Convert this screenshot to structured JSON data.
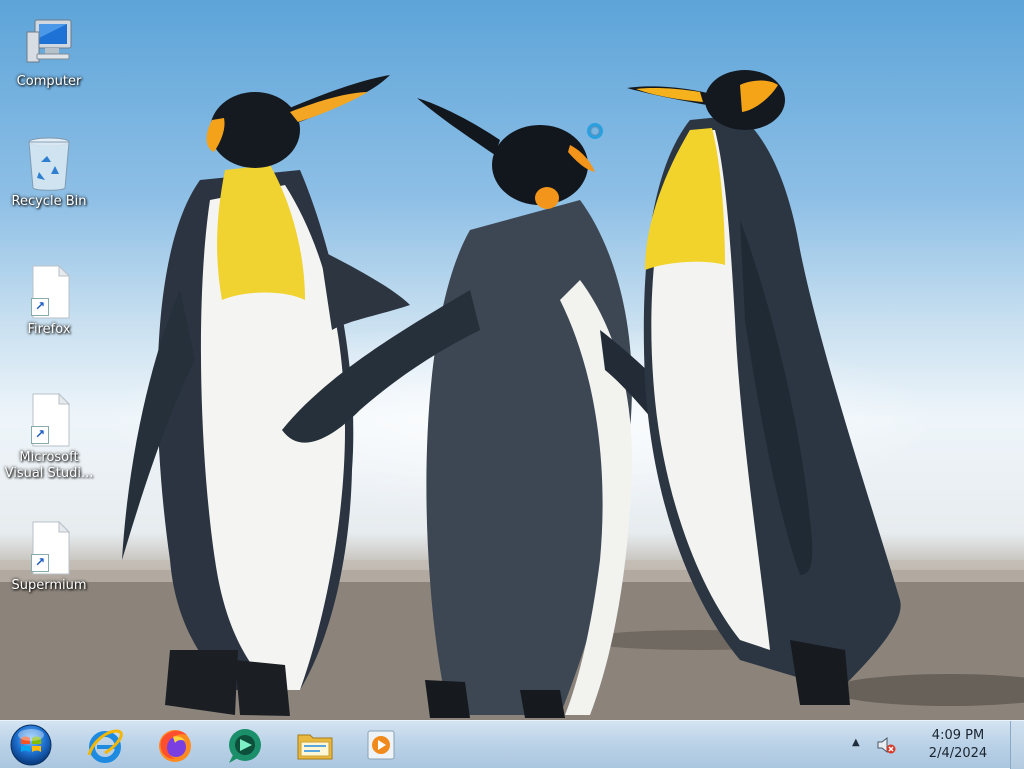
{
  "desktop": {
    "icons": [
      {
        "label": "Computer",
        "icon": "computer-icon"
      },
      {
        "label": "Recycle Bin",
        "icon": "recycle-bin-icon"
      },
      {
        "label": "Firefox",
        "icon": "file-shortcut-icon"
      },
      {
        "label": "Microsoft Visual Studi...",
        "icon": "file-shortcut-icon"
      },
      {
        "label": "Supermium",
        "icon": "file-shortcut-icon"
      }
    ]
  },
  "taskbar": {
    "pinned": [
      {
        "name": "Internet Explorer",
        "icon": "internet-explorer-icon"
      },
      {
        "name": "Firefox",
        "icon": "firefox-icon"
      },
      {
        "name": "Supermium",
        "icon": "supermium-icon"
      },
      {
        "name": "File Explorer",
        "icon": "folder-icon"
      },
      {
        "name": "Media Player",
        "icon": "media-player-icon"
      }
    ],
    "tray": {
      "time": "4:09 PM",
      "date": "2/4/2024"
    }
  },
  "colors": {
    "taskbar": "#bcd3e8",
    "start_orb": "#1d6fcf",
    "accent": "#2aa0e0"
  }
}
